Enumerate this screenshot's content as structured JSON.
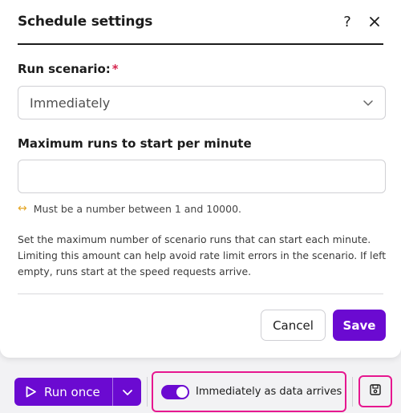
{
  "modal": {
    "title": "Schedule settings",
    "help_label": "?",
    "run_scenario": {
      "label": "Run scenario:",
      "required_marker": "*",
      "selected": "Immediately"
    },
    "max_runs": {
      "label": "Maximum runs to start per minute",
      "value": "",
      "placeholder": "",
      "hint": "Must be a number between 1 and 10000."
    },
    "description": "Set the maximum number of scenario runs that can start each minute. Limiting this amount can help avoid rate limit errors in the scenario. If left empty, runs start at the speed requests arrive.",
    "cancel_label": "Cancel",
    "save_label": "Save"
  },
  "toolbar": {
    "run_once_label": "Run once",
    "schedule_toggle_label": "Immediately as data arrives",
    "schedule_toggle_on": true
  },
  "colors": {
    "accent": "#6b0ad1",
    "highlight": "#e6178f",
    "required": "#d6244e",
    "hint_icon": "#e5a82a"
  },
  "icons": {
    "help": "question-icon",
    "close": "close-icon",
    "select": "chevron-down-icon",
    "hint": "arrows-horizontal-icon",
    "run": "play-icon",
    "run_menu": "chevron-down-icon",
    "save": "floppy-disk-icon"
  }
}
